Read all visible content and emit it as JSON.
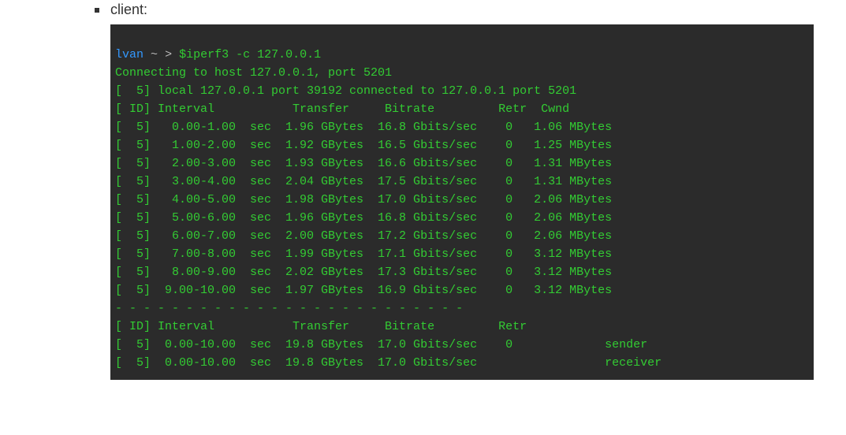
{
  "bullet_label": "client:",
  "prompt": {
    "host": "lvan",
    "path": "~",
    "gt": ">",
    "command": "$iperf3 -c 127.0.0.1"
  },
  "connecting_line": "Connecting to host 127.0.0.1, port 5201",
  "local_line": "[  5] local 127.0.0.1 port 39192 connected to 127.0.0.1 port 5201",
  "header_line": "[ ID] Interval           Transfer     Bitrate         Retr  Cwnd",
  "rows": [
    {
      "id": "5",
      "interval": "0.00-1.00",
      "unit": "sec",
      "transfer": "1.96 GBytes",
      "bitrate": "16.8 Gbits/sec",
      "retr": "0",
      "cwnd": "1.06 MBytes"
    },
    {
      "id": "5",
      "interval": "1.00-2.00",
      "unit": "sec",
      "transfer": "1.92 GBytes",
      "bitrate": "16.5 Gbits/sec",
      "retr": "0",
      "cwnd": "1.25 MBytes"
    },
    {
      "id": "5",
      "interval": "2.00-3.00",
      "unit": "sec",
      "transfer": "1.93 GBytes",
      "bitrate": "16.6 Gbits/sec",
      "retr": "0",
      "cwnd": "1.31 MBytes"
    },
    {
      "id": "5",
      "interval": "3.00-4.00",
      "unit": "sec",
      "transfer": "2.04 GBytes",
      "bitrate": "17.5 Gbits/sec",
      "retr": "0",
      "cwnd": "1.31 MBytes"
    },
    {
      "id": "5",
      "interval": "4.00-5.00",
      "unit": "sec",
      "transfer": "1.98 GBytes",
      "bitrate": "17.0 Gbits/sec",
      "retr": "0",
      "cwnd": "2.06 MBytes"
    },
    {
      "id": "5",
      "interval": "5.00-6.00",
      "unit": "sec",
      "transfer": "1.96 GBytes",
      "bitrate": "16.8 Gbits/sec",
      "retr": "0",
      "cwnd": "2.06 MBytes"
    },
    {
      "id": "5",
      "interval": "6.00-7.00",
      "unit": "sec",
      "transfer": "2.00 GBytes",
      "bitrate": "17.2 Gbits/sec",
      "retr": "0",
      "cwnd": "2.06 MBytes"
    },
    {
      "id": "5",
      "interval": "7.00-8.00",
      "unit": "sec",
      "transfer": "1.99 GBytes",
      "bitrate": "17.1 Gbits/sec",
      "retr": "0",
      "cwnd": "3.12 MBytes"
    },
    {
      "id": "5",
      "interval": "8.00-9.00",
      "unit": "sec",
      "transfer": "2.02 GBytes",
      "bitrate": "17.3 Gbits/sec",
      "retr": "0",
      "cwnd": "3.12 MBytes"
    },
    {
      "id": "5",
      "interval": "9.00-10.00",
      "unit": "sec",
      "transfer": "1.97 GBytes",
      "bitrate": "16.9 Gbits/sec",
      "retr": "0",
      "cwnd": "3.12 MBytes"
    }
  ],
  "separator": "- - - - - - - - - - - - - - - - - - - - - - - - -",
  "summary_header": "[ ID] Interval           Transfer     Bitrate         Retr",
  "summary_rows": [
    {
      "id": "5",
      "interval": "0.00-10.00",
      "unit": "sec",
      "transfer": "19.8 GBytes",
      "bitrate": "17.0 Gbits/sec",
      "retr": "0",
      "role": "sender"
    },
    {
      "id": "5",
      "interval": "0.00-10.00",
      "unit": "sec",
      "transfer": "19.8 GBytes",
      "bitrate": "17.0 Gbits/sec",
      "retr": "",
      "role": "receiver"
    }
  ]
}
